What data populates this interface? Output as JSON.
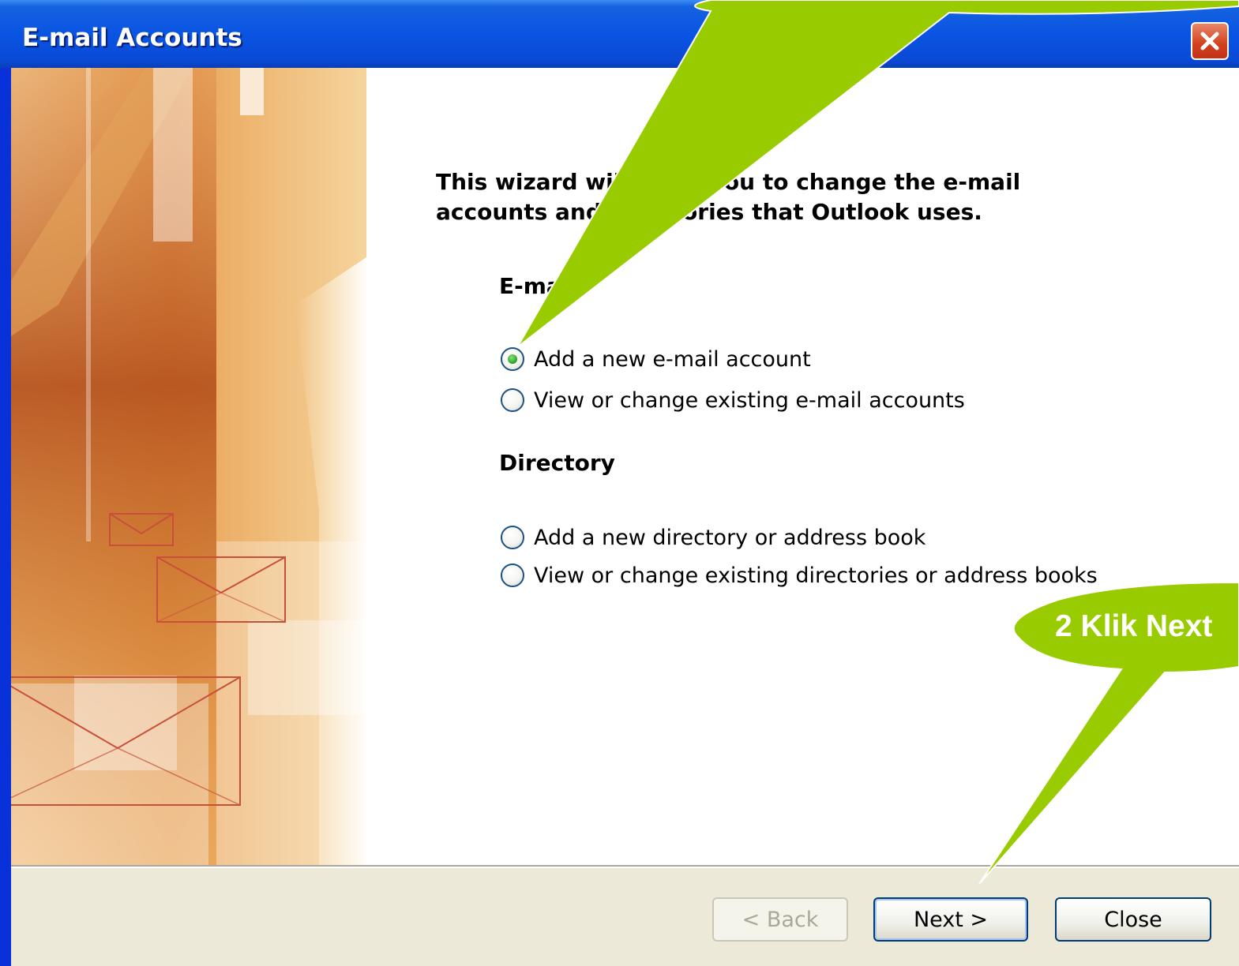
{
  "window": {
    "title": "E-mail Accounts",
    "close_icon": "close-icon"
  },
  "wizard": {
    "intro_line1": "This wizard will allow you to change the e-mail",
    "intro_line2": "accounts and directories that Outlook uses."
  },
  "email_section": {
    "heading": "E-mail",
    "options": [
      {
        "label": "Add a new e-mail account",
        "selected": true
      },
      {
        "label": "View or change existing e-mail accounts",
        "selected": false
      }
    ]
  },
  "directory_section": {
    "heading": "Directory",
    "options": [
      {
        "label": "Add a new directory or address book",
        "selected": false
      },
      {
        "label": "View or change existing directories or address books",
        "selected": false
      }
    ]
  },
  "buttons": {
    "back": "< Back",
    "next": "Next >",
    "close": "Close"
  },
  "annotations": {
    "callout_color": "#99cc00",
    "callout_next_text": "2 Klik Next"
  }
}
